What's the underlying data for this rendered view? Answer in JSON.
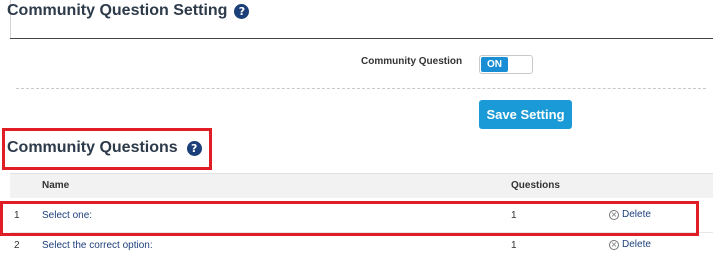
{
  "settings": {
    "title": "Community Question Setting",
    "help_glyph": "?",
    "community_question_label": "Community Question",
    "toggle_state": "ON",
    "save_label": "Save Setting"
  },
  "questions": {
    "title": "Community Questions",
    "help_glyph": "?",
    "columns": {
      "name": "Name",
      "questions": "Questions"
    },
    "rows": [
      {
        "index": "1",
        "name": "Select one:",
        "count": "1",
        "delete_label": "Delete"
      },
      {
        "index": "2",
        "name": "Select the correct option:",
        "count": "1",
        "delete_label": "Delete"
      }
    ]
  },
  "icons": {
    "help": "question-circle-icon",
    "delete": "close-circle-icon"
  },
  "colors": {
    "primary": "#1a9ad6",
    "toggle_on": "#1a8ed4",
    "link": "#1d3f7a",
    "highlight": "#e01c24"
  }
}
